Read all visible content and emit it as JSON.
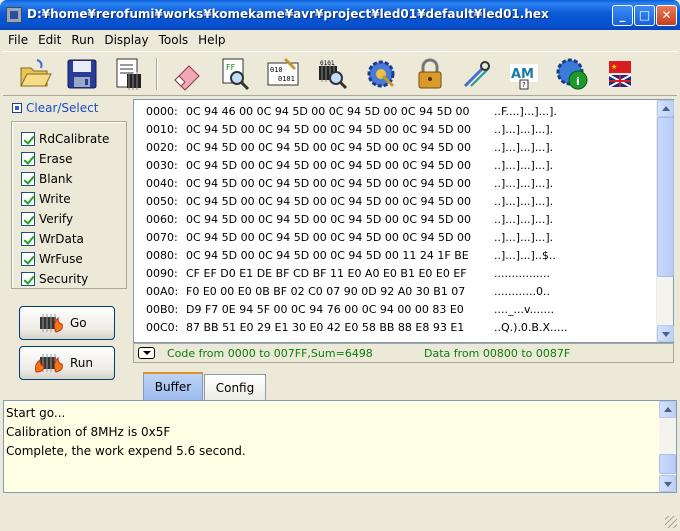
{
  "window": {
    "title": "D:¥home¥rerofumi¥works¥komekame¥avr¥project¥led01¥default¥led01.hex",
    "min_label": "_",
    "max_label": "□",
    "close_label": "✕"
  },
  "menu": [
    "File",
    "Edit",
    "Run",
    "Display",
    "Tools",
    "Help"
  ],
  "toolbar": {
    "buttons": [
      "open-folder",
      "save-disk",
      "chip-document",
      "eraser",
      "flash-search",
      "binary-edit",
      "chip-search",
      "security-settings",
      "padlock",
      "probe-tool",
      "help-atmel",
      "globe-info",
      "language-flags"
    ]
  },
  "left_panel": {
    "clear_select": "Clear/Select",
    "options": [
      "RdCalibrate",
      "Erase",
      "Blank",
      "Write",
      "Verify",
      "WrData",
      "WrFuse",
      "Security"
    ],
    "go_label": "Go",
    "run_label": "Run"
  },
  "hex": {
    "rows": [
      {
        "addr": "0000:",
        "bytes": "0C 94 46 00 0C 94 5D 00 0C 94 5D 00 0C 94 5D 00",
        "ascii": "..F....]...]...]."
      },
      {
        "addr": "0010:",
        "bytes": "0C 94 5D 00 0C 94 5D 00 0C 94 5D 00 0C 94 5D 00",
        "ascii": "..]...]...]...]."
      },
      {
        "addr": "0020:",
        "bytes": "0C 94 5D 00 0C 94 5D 00 0C 94 5D 00 0C 94 5D 00",
        "ascii": "..]...]...]...]."
      },
      {
        "addr": "0030:",
        "bytes": "0C 94 5D 00 0C 94 5D 00 0C 94 5D 00 0C 94 5D 00",
        "ascii": "..]...]...]...]."
      },
      {
        "addr": "0040:",
        "bytes": "0C 94 5D 00 0C 94 5D 00 0C 94 5D 00 0C 94 5D 00",
        "ascii": "..]...]...]...]."
      },
      {
        "addr": "0050:",
        "bytes": "0C 94 5D 00 0C 94 5D 00 0C 94 5D 00 0C 94 5D 00",
        "ascii": "..]...]...]...]."
      },
      {
        "addr": "0060:",
        "bytes": "0C 94 5D 00 0C 94 5D 00 0C 94 5D 00 0C 94 5D 00",
        "ascii": "..]...]...]...]."
      },
      {
        "addr": "0070:",
        "bytes": "0C 94 5D 00 0C 94 5D 00 0C 94 5D 00 0C 94 5D 00",
        "ascii": "..]...]...]...]."
      },
      {
        "addr": "0080:",
        "bytes": "0C 94 5D 00 0C 94 5D 00 0C 94 5D 00 11 24 1F BE",
        "ascii": "..]...]...]..$.."
      },
      {
        "addr": "0090:",
        "bytes": "CF EF D0 E1 DE BF CD BF 11 E0 A0 E0 B1 E0 E0 EF",
        "ascii": "................"
      },
      {
        "addr": "00A0:",
        "bytes": "F0 E0 00 E0 0B BF 02 C0 07 90 0D 92 A0 30 B1 07",
        "ascii": "............0.."
      },
      {
        "addr": "00B0:",
        "bytes": "D9 F7 0E 94 5F 00 0C 94 76 00 0C 94 00 00 83 E0",
        "ascii": "...._...v......."
      },
      {
        "addr": "00C0:",
        "bytes": "87 BB 51 E0 29 E1 30 E0 42 E0 58 BB 88 E8 93 E1",
        "ascii": "..Q.).0.B.X....."
      }
    ],
    "code_info": "Code from 0000 to 007FF,Sum=6498",
    "data_info": "Data from 00800 to 0087F"
  },
  "tabs": [
    "Buffer",
    "Config"
  ],
  "log": [
    "Start go...",
    "Calibration of 8MHz is 0x5F",
    "Complete,  the work expend 5.6 second."
  ]
}
